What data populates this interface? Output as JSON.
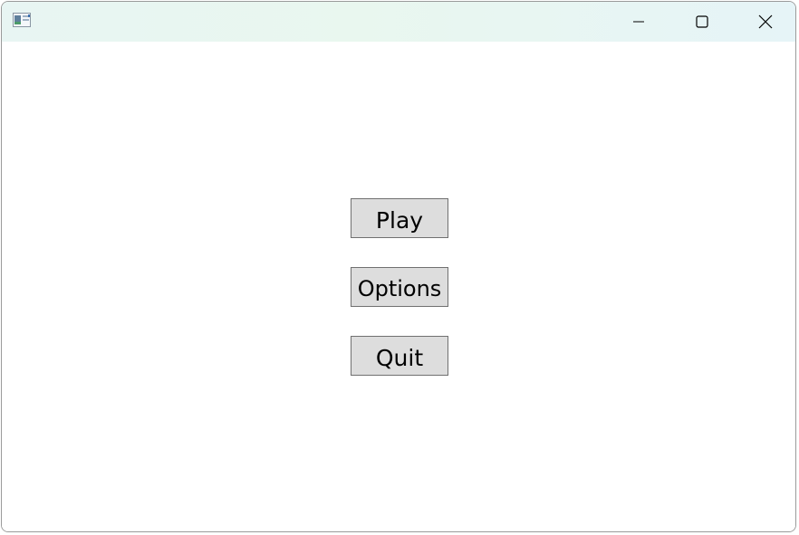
{
  "window": {
    "title": "",
    "icon": "app-window-icon",
    "controls": {
      "minimize_icon": "minimize-icon",
      "maximize_icon": "maximize-icon",
      "close_icon": "close-icon"
    }
  },
  "menu": {
    "buttons": [
      {
        "label": "Play"
      },
      {
        "label": "Options"
      },
      {
        "label": "Quit"
      }
    ]
  },
  "colors": {
    "button_face": "#dddddd",
    "button_border": "#707070",
    "titlebar_tint": "#e8f5f3"
  }
}
